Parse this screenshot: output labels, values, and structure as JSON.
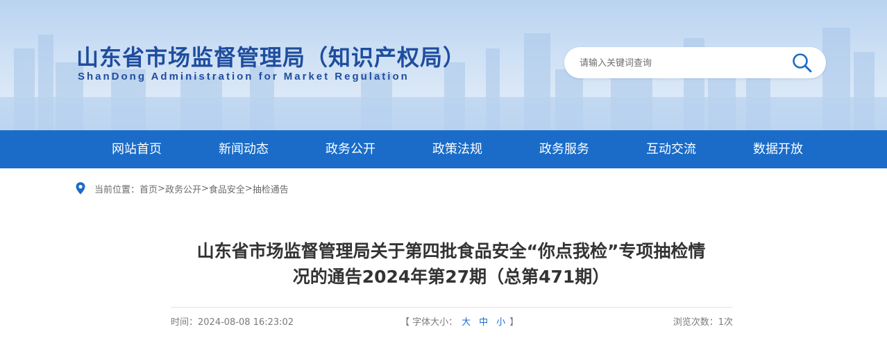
{
  "header": {
    "title": "山东省市场监督管理局（知识产权局）",
    "subtitle": "ShanDong Administration for Market Regulation",
    "search_placeholder": "请输入关键词查询"
  },
  "nav": {
    "items": [
      "网站首页",
      "新闻动态",
      "政务公开",
      "政策法规",
      "政务服务",
      "互动交流",
      "数据开放"
    ]
  },
  "breadcrumb": {
    "prefix": "当前位置：",
    "items": [
      "首页",
      "政务公开",
      "食品安全",
      "抽检通告"
    ],
    "separator": ">"
  },
  "article": {
    "title_line1": "山东省市场监督管理局关于第四批食品安全“你点我检”专项抽检情",
    "title_line2": "况的通告2024年第27期（总第471期）",
    "time_label": "时间：",
    "time_value": "2024-08-08 16:23:02",
    "font_open": "【 字体大小：",
    "font_large": "大",
    "font_medium": "中",
    "font_small": "小",
    "font_close": "】",
    "views_label": "浏览次数：",
    "views_value": "1次"
  },
  "colors": {
    "nav_bg": "#1a6cc8",
    "title_blue": "#1f4d9e"
  }
}
